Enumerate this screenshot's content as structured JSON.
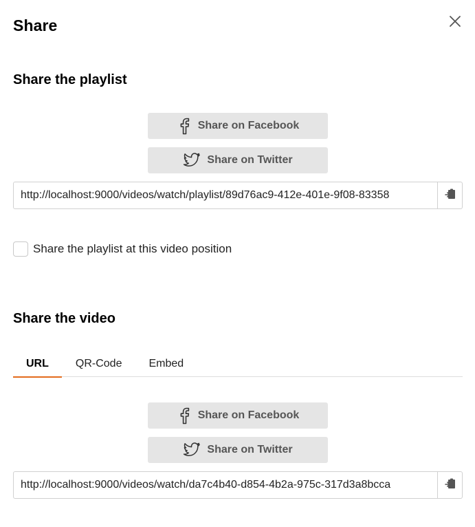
{
  "dialog": {
    "title": "Share",
    "close_icon": "close-icon"
  },
  "playlist": {
    "heading": "Share the playlist",
    "facebook_label": "Share on Facebook",
    "twitter_label": "Share on Twitter",
    "url": "http://localhost:9000/videos/watch/playlist/89d76ac9-412e-401e-9f08-83358",
    "checkbox_label": "Share the playlist at this video position",
    "checkbox_checked": false
  },
  "video": {
    "heading": "Share the video",
    "tabs": [
      {
        "label": "URL",
        "active": true
      },
      {
        "label": "QR-Code",
        "active": false
      },
      {
        "label": "Embed",
        "active": false
      }
    ],
    "facebook_label": "Share on Facebook",
    "twitter_label": "Share on Twitter",
    "url": "http://localhost:9000/videos/watch/da7c4b40-d854-4b2a-975c-317d3a8bcca"
  },
  "colors": {
    "accent": "#e36a1b",
    "button_bg": "#e5e5e5"
  }
}
